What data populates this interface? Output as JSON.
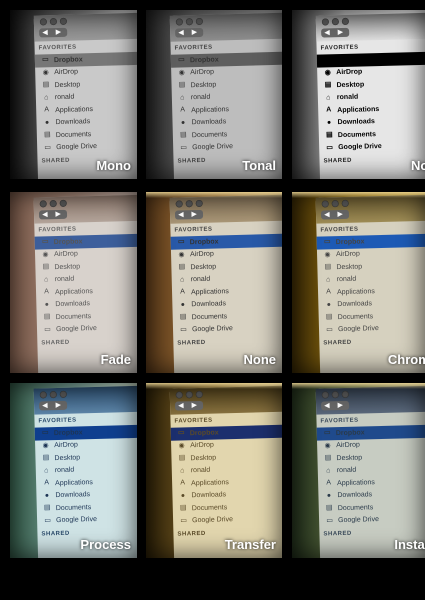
{
  "sidebar": {
    "favorites_header": "FAVORITES",
    "shared_header": "SHARED",
    "nav_arrows": "◀ ▶",
    "items": [
      {
        "label": "Dropbox",
        "icon": "dropbox-folder-icon",
        "glyph": "▭"
      },
      {
        "label": "AirDrop",
        "icon": "airdrop-icon",
        "glyph": "◉"
      },
      {
        "label": "Desktop",
        "icon": "desktop-icon",
        "glyph": "▤"
      },
      {
        "label": "ronald",
        "icon": "home-icon",
        "glyph": "⌂"
      },
      {
        "label": "Applications",
        "icon": "applications-icon",
        "glyph": "A"
      },
      {
        "label": "Downloads",
        "icon": "downloads-icon",
        "glyph": "●"
      },
      {
        "label": "Documents",
        "icon": "documents-icon",
        "glyph": "▤"
      },
      {
        "label": "Google Drive",
        "icon": "google-drive-folder-icon",
        "glyph": "▭"
      }
    ]
  },
  "filters": [
    {
      "label": "Mono",
      "style": "mono"
    },
    {
      "label": "Tonal",
      "style": "tonal"
    },
    {
      "label": "Noir",
      "style": "noir"
    },
    {
      "label": "Fade",
      "style": "fade"
    },
    {
      "label": "None",
      "style": "none"
    },
    {
      "label": "Chrome",
      "style": "chrome"
    },
    {
      "label": "Process",
      "style": "process"
    },
    {
      "label": "Transfer",
      "style": "transfer"
    },
    {
      "label": "Instant",
      "style": "instant"
    }
  ]
}
